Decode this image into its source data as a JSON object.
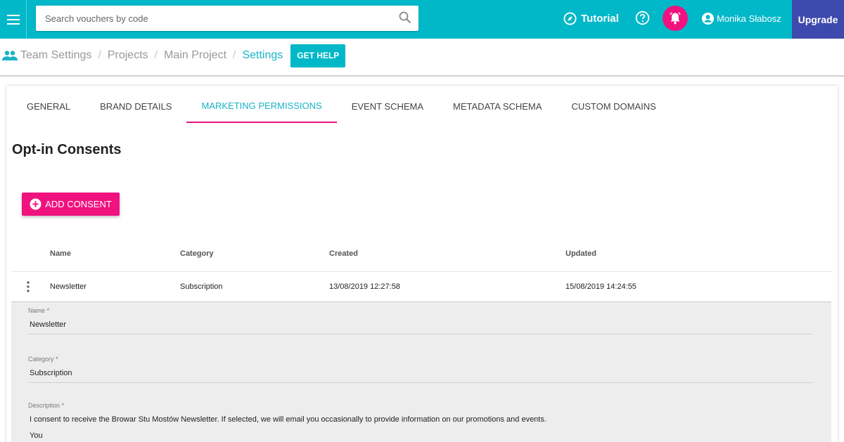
{
  "topbar": {
    "search_placeholder": "Search vouchers by code",
    "tutorial_label": "Tutorial",
    "user_name": "Monika Słabosz",
    "upgrade_label": "Upgrade"
  },
  "breadcrumb": {
    "items": [
      "Team Settings",
      "Projects",
      "Main Project",
      "Settings"
    ],
    "get_help_label": "GET HELP"
  },
  "tabs": [
    "GENERAL",
    "BRAND DETAILS",
    "MARKETING PERMISSIONS",
    "EVENT SCHEMA",
    "METADATA SCHEMA",
    "CUSTOM DOMAINS"
  ],
  "active_tab": "MARKETING PERMISSIONS",
  "section": {
    "title": "Opt-in Consents",
    "add_button_label": "ADD CONSENT"
  },
  "table": {
    "headers": [
      "Name",
      "Category",
      "Created",
      "Updated"
    ],
    "rows": [
      {
        "name": "Newsletter",
        "category": "Subscription",
        "created": "13/08/2019 12:27:58",
        "updated": "15/08/2019 14:24:55"
      }
    ]
  },
  "form": {
    "name_label": "Name *",
    "name_value": "Newsletter",
    "category_label": "Category *",
    "category_value": "Subscription",
    "description_label": "Description *",
    "description_line1": "I consent to receive the Browar Stu Mostów Newsletter. If selected, we will email you occasionally to provide information on our promotions and events.",
    "description_line2": "You"
  },
  "colors": {
    "topbar": "#00b8c8",
    "accent_pink": "#f0127f",
    "upgrade": "#3e49ad",
    "active_tab_text": "#1ab3c6"
  },
  "icons": {
    "menu": "hamburger-icon",
    "search": "search-icon",
    "tutorial": "compass-icon",
    "help": "help-icon",
    "notification": "bell-icon",
    "user": "account-icon",
    "team": "people-icon",
    "add": "plus-circle-icon",
    "row_menu": "more-vertical-icon"
  }
}
